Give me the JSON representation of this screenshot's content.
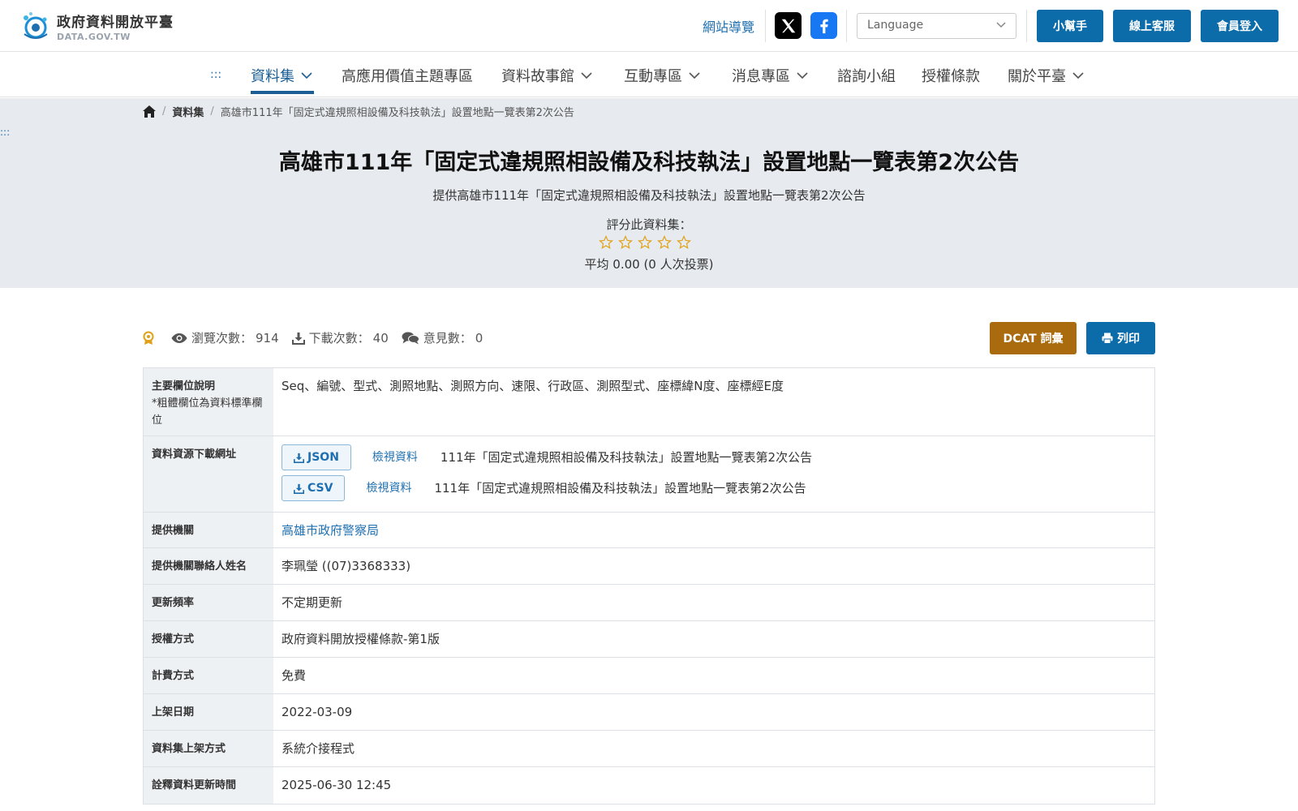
{
  "header": {
    "logo_title": "政府資料開放平臺",
    "logo_subtitle": "DATA.GOV.TW",
    "sitemap": "網站導覽",
    "language_placeholder": "Language",
    "buttons": [
      "小幫手",
      "線上客服",
      "會員登入"
    ]
  },
  "nav": {
    "accesskey": ":::",
    "items": [
      "資料集",
      "高應用價值主題專區",
      "資料故事館",
      "互動專區",
      "消息專區",
      "諮詢小組",
      "授權條款",
      "關於平臺"
    ]
  },
  "breadcrumb": {
    "level1": "資料集",
    "current": "高雄市111年「固定式違規照相設備及科技執法」設置地點一覽表第2次公告"
  },
  "accesskey_marker": ":::",
  "dataset": {
    "title": "高雄市111年「固定式違規照相設備及科技執法」設置地點一覽表第2次公告",
    "subtitle": "提供高雄市111年「固定式違規照相設備及科技執法」設置地點一覽表第2次公告",
    "rating_label": "評分此資料集：",
    "rating_value": 0,
    "rating_average": "平均 0.00 (0 人次投票)"
  },
  "stats": {
    "views_label": "瀏覽次數：",
    "views": "914",
    "downloads_label": "下載次數：",
    "downloads": "40",
    "comments_label": "意見數：",
    "comments": "0"
  },
  "actions": {
    "dcat": "DCAT 詞彙",
    "print": "列印"
  },
  "table": {
    "fields_header": "主要欄位說明",
    "fields_note": "*粗體欄位為資料標準欄位",
    "fields_value": "Seq、編號、型式、測照地點、測照方向、速限、行政區、測照型式、座標緯N度、座標經E度",
    "resources_header": "資料資源下載網址",
    "resources": [
      {
        "format": "JSON",
        "view": "檢視資料",
        "name": "111年「固定式違規照相設備及科技執法」設置地點一覽表第2次公告"
      },
      {
        "format": "CSV",
        "view": "檢視資料",
        "name": "111年「固定式違規照相設備及科技執法」設置地點一覽表第2次公告"
      }
    ],
    "rows": [
      {
        "label": "提供機關",
        "value": "高雄市政府警察局"
      },
      {
        "label": "提供機關聯絡人姓名",
        "value": "李珮瑩 ((07)3368333)"
      },
      {
        "label": "更新頻率",
        "value": "不定期更新"
      },
      {
        "label": "授權方式",
        "value": "政府資料開放授權條款-第1版"
      },
      {
        "label": "計費方式",
        "value": "免費"
      },
      {
        "label": "上架日期",
        "value": "2022-03-09"
      },
      {
        "label": "資料集上架方式",
        "value": "系統介接程式"
      },
      {
        "label": "詮釋資料更新時間",
        "value": "2025-06-30 12:45"
      }
    ]
  }
}
